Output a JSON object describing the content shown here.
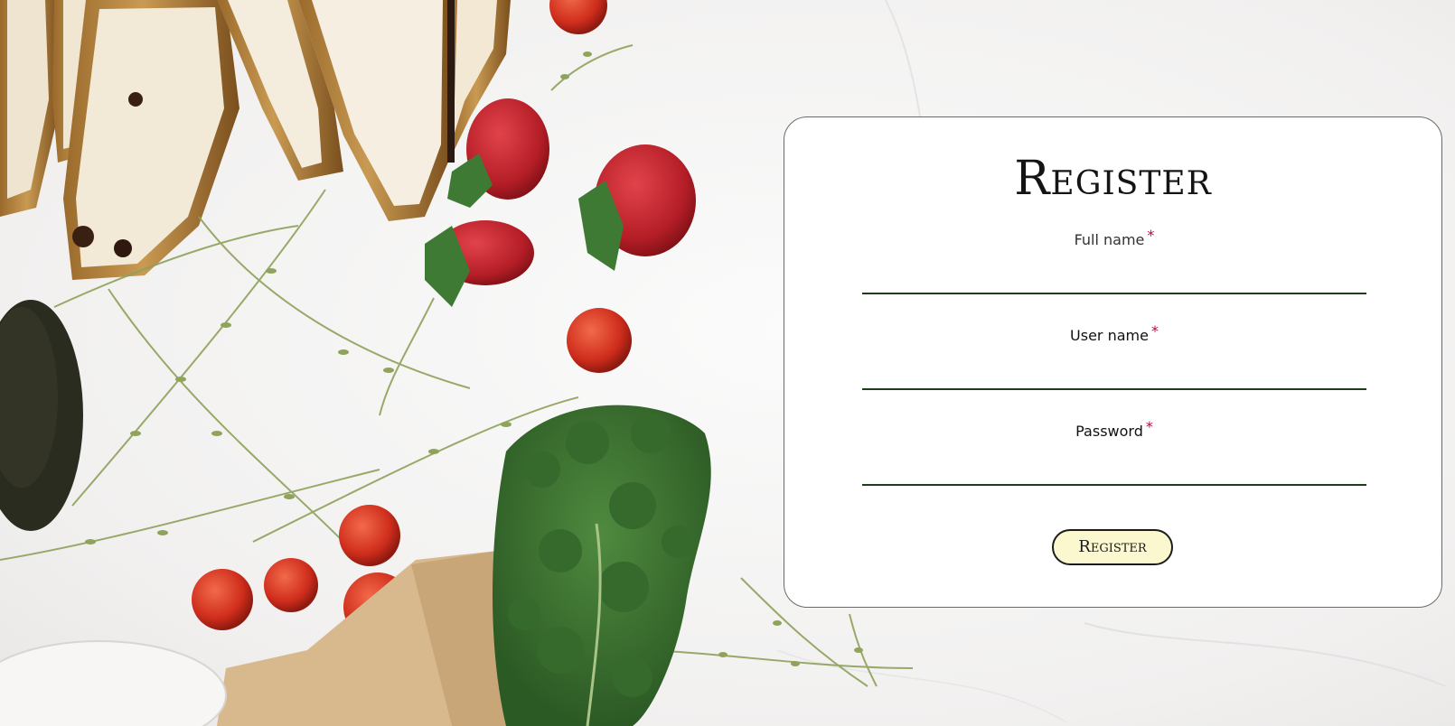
{
  "register_card": {
    "title": "Register",
    "fields": [
      {
        "label": "Full name",
        "required_mark": "*",
        "value": ""
      },
      {
        "label": "User name",
        "required_mark": "*",
        "value": ""
      },
      {
        "label": "Password",
        "required_mark": "*",
        "value": ""
      }
    ],
    "submit_label": "Register"
  },
  "colors": {
    "card_background": "#ffffff",
    "input_underline": "#1e3c1c",
    "required_mark": "#c4004a",
    "button_background": "#fbf8cf"
  }
}
